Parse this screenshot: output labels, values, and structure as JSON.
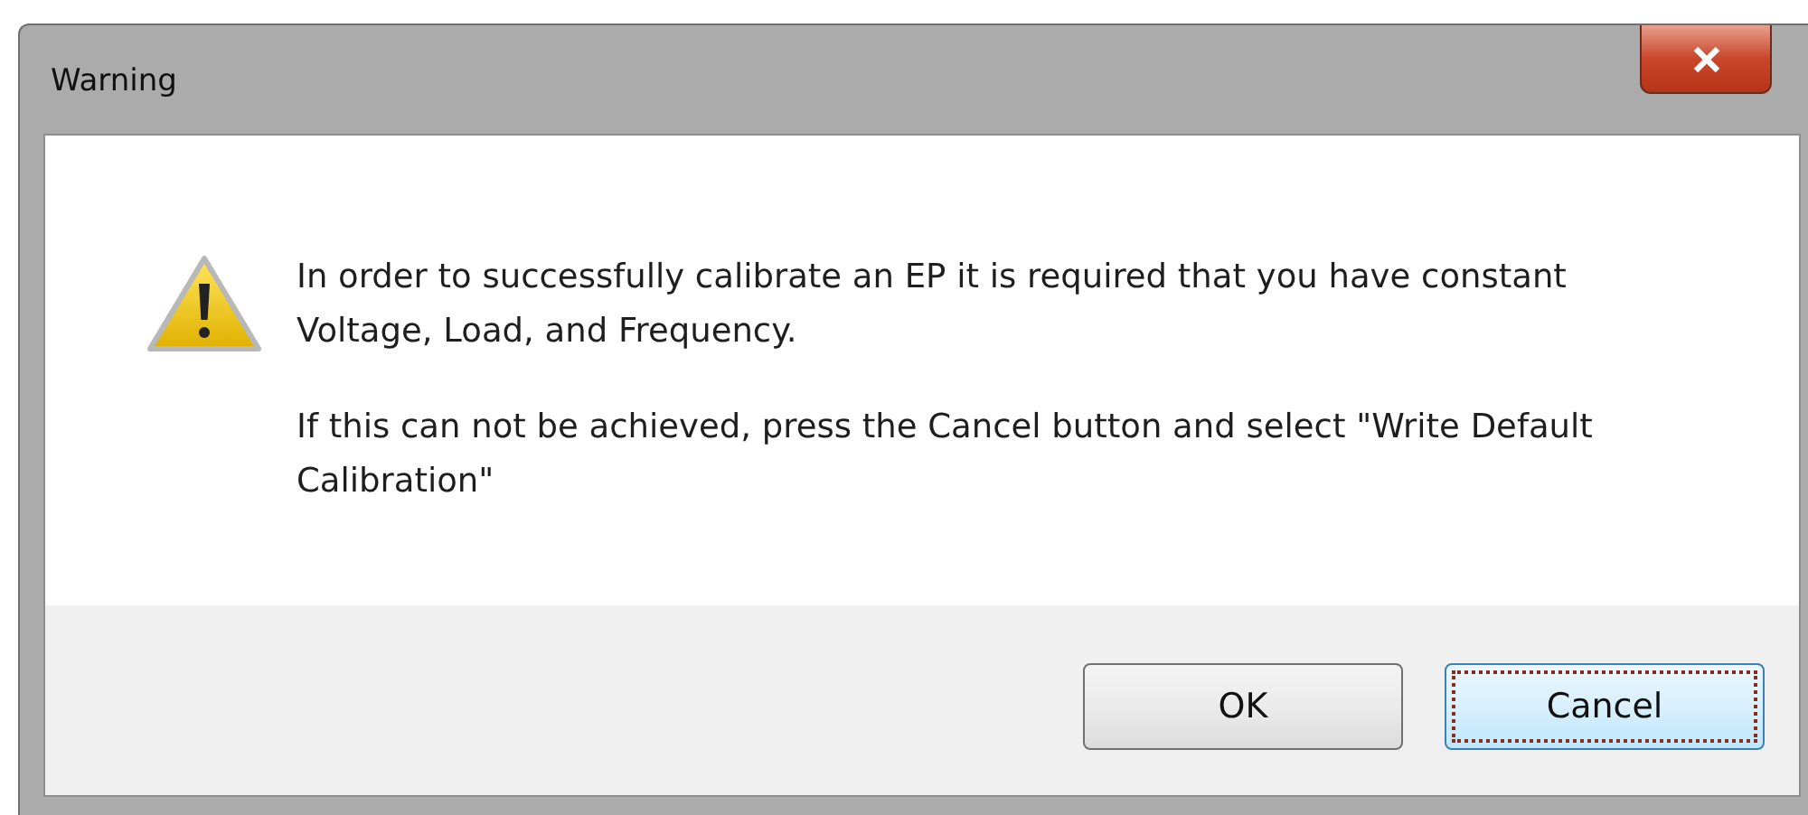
{
  "window": {
    "title": "Warning"
  },
  "message": {
    "paragraphs": [
      "In order to successfully calibrate an EP it is required that you have constant Voltage, Load, and Frequency.",
      "If this can not be achieved, press the Cancel button and select \"Write Default Calibration\""
    ]
  },
  "buttons": [
    {
      "label": "OK",
      "focused": false
    },
    {
      "label": "Cancel",
      "focused": true
    }
  ]
}
